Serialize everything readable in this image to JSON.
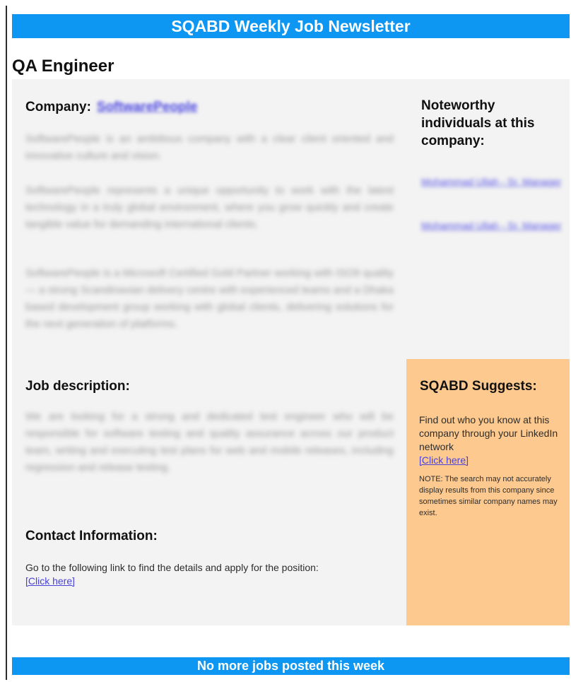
{
  "newsletter": {
    "title": "SQABD Weekly Job Newsletter",
    "footer": "No more jobs posted this week"
  },
  "job": {
    "title": "QA Engineer",
    "company_label": "Company:",
    "company_name": "SoftwarePeople",
    "company_paragraphs": [
      "SoftwarePeople is an ambitious company with a clear client oriented and innovative culture and vision.",
      "SoftwarePeople represents a unique opportunity to work with the latest technology in a truly global environment, where you grow quickly and create tangible value for demanding international clients.",
      "SoftwarePeople is a Microsoft Certified Gold Partner working with ISO9 quality — a strong Scandinavian delivery centre with experienced teams and a Dhaka based development group working with global clients, delivering solutions for the next generation of platforms."
    ],
    "description_label": "Job description:",
    "description_text": "We are looking for a strong and dedicated test engineer who will be responsible for software testing and quality assurance across our product team, writing and executing test plans for web and mobile releases, including regression and release testing.",
    "contact_label": "Contact Information:",
    "contact_text": "Go to the following link to find the details and apply for the position:",
    "contact_link": "[Click here]"
  },
  "noteworthy": {
    "heading": "Noteworthy individuals at this company:",
    "links": [
      "Mohammad Ullah - Sr. Manager",
      "Mohammad Ullah - Sr. Manager"
    ]
  },
  "suggest": {
    "heading": "SQABD Suggests:",
    "text": "Find out who you know at this company through your LinkedIn network",
    "link": "[Click here]",
    "note": "NOTE: The search may not accurately display results from this company since sometimes similar company names may exist."
  }
}
